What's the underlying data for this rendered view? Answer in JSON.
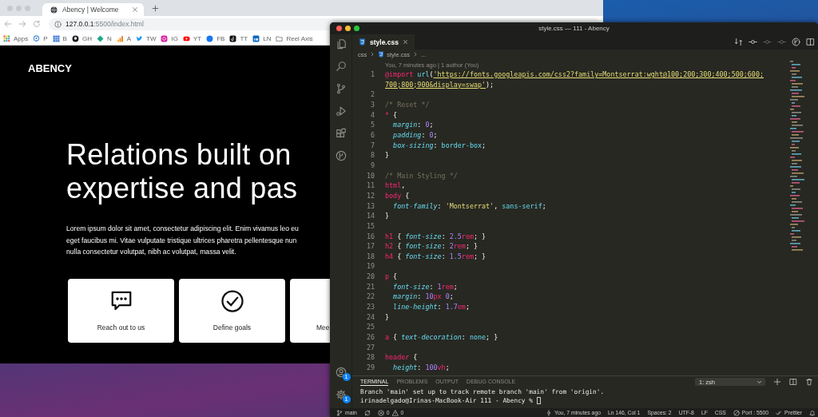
{
  "browser": {
    "tab_title": "Abency | Welcome",
    "address": "**127.0.0.1**:5500/index.html",
    "bookmarks": [
      {
        "label": "Apps"
      },
      {
        "label": "P"
      },
      {
        "label": "B"
      },
      {
        "label": "GH"
      },
      {
        "label": "N"
      },
      {
        "label": "A"
      },
      {
        "label": "TW"
      },
      {
        "label": "IG"
      },
      {
        "label": "YT"
      },
      {
        "label": "FB"
      },
      {
        "label": "TT"
      },
      {
        "label": "LN"
      },
      {
        "label": "Reel Axis"
      }
    ],
    "page": {
      "logo": "ABENCY",
      "heading_lines": [
        "Relations built on",
        "expertise and pas"
      ],
      "intro_lines": [
        "Lorem ipsum dolor sit amet, consectetur adipiscing elit. Enim vivamus leo eu",
        "eget faucibus mi. Vitae vulputate tristique ultrices pharetra pellentesque nun",
        "nulla consectetur volutpat, nibh ac volutpat, massa velit."
      ],
      "cards": [
        {
          "label": "Reach out to us"
        },
        {
          "label": "Define goals"
        },
        {
          "label": "Mee"
        }
      ]
    }
  },
  "editor": {
    "title": "style.css — 111 - Abency",
    "tab": "style.css",
    "breadcrumb": [
      "css",
      "style.css",
      "..."
    ],
    "codelens": "You, 7 minutes ago | 1 author (You)",
    "account_badge": "1",
    "settings_badge": "1",
    "lines": [
      {
        "number": "1",
        "tokens": [
          {
            "kind": "keyword",
            "text": "@import "
          },
          {
            "kind": "function",
            "text": "url"
          },
          {
            "kind": "plain",
            "text": "("
          },
          {
            "kind": "link",
            "text": "'https://fonts.googleapis.com/css2?family=Montserrat:wght@100;200;300;400;500;600;"
          },
          {
            "kind": "wrap"
          },
          {
            "kind": "link",
            "text": "700;800;900&display=swap'"
          },
          {
            "kind": "plain",
            "text": ");"
          }
        ]
      },
      {
        "number": "2"
      },
      {
        "number": "3",
        "tokens": [
          {
            "kind": "comment",
            "text": "/* Reset */"
          }
        ]
      },
      {
        "number": "4",
        "tokens": [
          {
            "kind": "selector",
            "text": "*"
          },
          {
            "kind": "plain",
            "text": " {"
          }
        ]
      },
      {
        "number": "5",
        "tokens": [
          {
            "kind": "property",
            "text": "  margin"
          },
          {
            "kind": "plain",
            "text": ": "
          },
          {
            "kind": "number",
            "text": "0"
          },
          {
            "kind": "plain",
            "text": ";"
          }
        ]
      },
      {
        "number": "6",
        "tokens": [
          {
            "kind": "property",
            "text": "  padding"
          },
          {
            "kind": "plain",
            "text": ": "
          },
          {
            "kind": "number",
            "text": "0"
          },
          {
            "kind": "plain",
            "text": ";"
          }
        ]
      },
      {
        "number": "7",
        "tokens": [
          {
            "kind": "property",
            "text": "  box-sizing"
          },
          {
            "kind": "plain",
            "text": ": "
          },
          {
            "kind": "value",
            "text": "border-box"
          },
          {
            "kind": "plain",
            "text": ";"
          }
        ]
      },
      {
        "number": "8",
        "tokens": [
          {
            "kind": "plain",
            "text": "}"
          }
        ]
      },
      {
        "number": "9"
      },
      {
        "number": "10",
        "tokens": [
          {
            "kind": "comment",
            "text": "/* Main Styling */"
          }
        ]
      },
      {
        "number": "11",
        "tokens": [
          {
            "kind": "selector",
            "text": "html"
          },
          {
            "kind": "plain",
            "text": ","
          }
        ]
      },
      {
        "number": "12",
        "tokens": [
          {
            "kind": "selector",
            "text": "body"
          },
          {
            "kind": "plain",
            "text": " {"
          }
        ]
      },
      {
        "number": "13",
        "tokens": [
          {
            "kind": "property",
            "text": "  font-family"
          },
          {
            "kind": "plain",
            "text": ": "
          },
          {
            "kind": "string",
            "text": "'Montserrat'"
          },
          {
            "kind": "plain",
            "text": ", "
          },
          {
            "kind": "value",
            "text": "sans-serif"
          },
          {
            "kind": "plain",
            "text": ";"
          }
        ]
      },
      {
        "number": "14",
        "tokens": [
          {
            "kind": "plain",
            "text": "}"
          }
        ]
      },
      {
        "number": "15"
      },
      {
        "number": "16",
        "tokens": [
          {
            "kind": "selector",
            "text": "h1"
          },
          {
            "kind": "plain",
            "text": " { "
          },
          {
            "kind": "property",
            "text": "font-size"
          },
          {
            "kind": "plain",
            "text": ": "
          },
          {
            "kind": "number",
            "text": "2.5"
          },
          {
            "kind": "unit",
            "text": "rem"
          },
          {
            "kind": "plain",
            "text": "; }"
          }
        ]
      },
      {
        "number": "17",
        "tokens": [
          {
            "kind": "selector",
            "text": "h2"
          },
          {
            "kind": "plain",
            "text": " { "
          },
          {
            "kind": "property",
            "text": "font-size"
          },
          {
            "kind": "plain",
            "text": ": "
          },
          {
            "kind": "number",
            "text": "2"
          },
          {
            "kind": "unit",
            "text": "rem"
          },
          {
            "kind": "plain",
            "text": "; }"
          }
        ]
      },
      {
        "number": "18",
        "tokens": [
          {
            "kind": "selector",
            "text": "h4"
          },
          {
            "kind": "plain",
            "text": " { "
          },
          {
            "kind": "property",
            "text": "font-size"
          },
          {
            "kind": "plain",
            "text": ": "
          },
          {
            "kind": "number",
            "text": "1.5"
          },
          {
            "kind": "unit",
            "text": "rem"
          },
          {
            "kind": "plain",
            "text": "; }"
          }
        ]
      },
      {
        "number": "19"
      },
      {
        "number": "20",
        "tokens": [
          {
            "kind": "selector",
            "text": "p"
          },
          {
            "kind": "plain",
            "text": " {"
          }
        ]
      },
      {
        "number": "21",
        "tokens": [
          {
            "kind": "property",
            "text": "  font-size"
          },
          {
            "kind": "plain",
            "text": ": "
          },
          {
            "kind": "number",
            "text": "1"
          },
          {
            "kind": "unit",
            "text": "rem"
          },
          {
            "kind": "plain",
            "text": ";"
          }
        ]
      },
      {
        "number": "22",
        "tokens": [
          {
            "kind": "property",
            "text": "  margin"
          },
          {
            "kind": "plain",
            "text": ": "
          },
          {
            "kind": "number",
            "text": "10"
          },
          {
            "kind": "unit",
            "text": "px"
          },
          {
            "kind": "number",
            "text": " 0"
          },
          {
            "kind": "plain",
            "text": ";"
          }
        ]
      },
      {
        "number": "23",
        "tokens": [
          {
            "kind": "property",
            "text": "  line-height"
          },
          {
            "kind": "plain",
            "text": ": "
          },
          {
            "kind": "number",
            "text": "1.7"
          },
          {
            "kind": "unit",
            "text": "em"
          },
          {
            "kind": "plain",
            "text": ";"
          }
        ]
      },
      {
        "number": "24",
        "tokens": [
          {
            "kind": "plain",
            "text": "}"
          }
        ]
      },
      {
        "number": "25"
      },
      {
        "number": "26",
        "tokens": [
          {
            "kind": "selector",
            "text": "a"
          },
          {
            "kind": "plain",
            "text": " { "
          },
          {
            "kind": "property",
            "text": "text-decoration"
          },
          {
            "kind": "plain",
            "text": ": "
          },
          {
            "kind": "value",
            "text": "none"
          },
          {
            "kind": "plain",
            "text": "; }"
          }
        ]
      },
      {
        "number": "27"
      },
      {
        "number": "28",
        "tokens": [
          {
            "kind": "selector",
            "text": "header"
          },
          {
            "kind": "plain",
            "text": " {"
          }
        ]
      },
      {
        "number": "29",
        "tokens": [
          {
            "kind": "property",
            "text": "  height"
          },
          {
            "kind": "plain",
            "text": ": "
          },
          {
            "kind": "number",
            "text": "100"
          },
          {
            "kind": "unit",
            "text": "vh"
          },
          {
            "kind": "plain",
            "text": ";"
          }
        ]
      }
    ],
    "panel": {
      "tabs": [
        {
          "label": "TERMINAL",
          "selected": true
        },
        {
          "label": "PROBLEMS",
          "selected": false
        },
        {
          "label": "OUTPUT",
          "selected": false
        },
        {
          "label": "DEBUG CONSOLE",
          "selected": false
        }
      ],
      "shell": "1: zsh",
      "output": [
        "Branch 'main' set up to track remote branch 'main' from 'origin'.",
        "irinadelgado@Irinas-MacBook-Air 111 - Abency %"
      ]
    },
    "status_bar": {
      "branch": "main",
      "errors": "0",
      "warnings": "0",
      "blame": "You, 7 minutes ago",
      "position": "Ln 146, Col 1",
      "indent": "Spaces: 2",
      "encoding": "UTF-8",
      "eol": "LF",
      "language": "CSS",
      "port": "Port : 5500",
      "formatter": "Prettier"
    }
  }
}
